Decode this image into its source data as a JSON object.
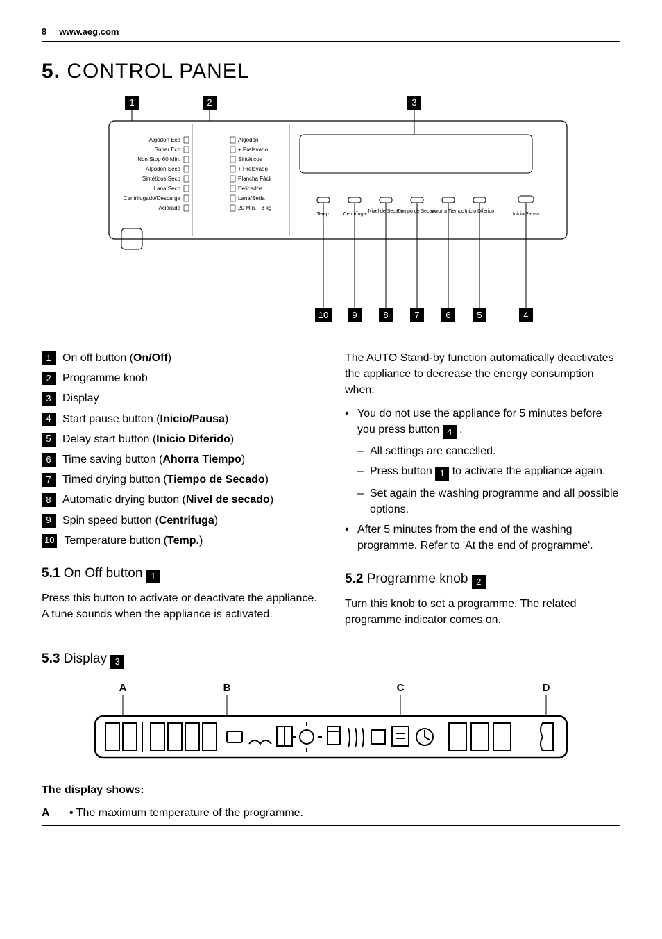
{
  "header": {
    "page_num": "8",
    "site": "www.aeg.com"
  },
  "title": {
    "num": "5.",
    "text": "CONTROL PANEL"
  },
  "panel": {
    "top_callouts": [
      "1",
      "2",
      "3"
    ],
    "bottom_callouts": [
      "10",
      "9",
      "8",
      "7",
      "6",
      "5",
      "4"
    ],
    "left_labels": [
      "Algodón Eco",
      "Super Eco",
      "Non Stop 60 Min.",
      "Algodón Seco",
      "Sintéticos Seco",
      "Lana Seco",
      "Centrifugado/Descarga",
      "Aclarado"
    ],
    "right_labels": [
      "Algodón",
      "+ Prelavado",
      "Sintéticos",
      "+ Prelavado",
      "Plancha Fácil",
      "Delicados",
      "Lana/Seda",
      "20 Min. · 3 kg"
    ],
    "button_labels": [
      "Temp.",
      "Centrífuga",
      "Nivel de Secado",
      "Tiempo de Secado",
      "Ahorra Tiempo",
      "Inicio Diferido",
      "Inicio/Pausa"
    ]
  },
  "legend": [
    {
      "n": "1",
      "text": "On off button (",
      "bold": "On/Off",
      "after": ")"
    },
    {
      "n": "2",
      "text": "Programme knob",
      "bold": "",
      "after": ""
    },
    {
      "n": "3",
      "text": "Display",
      "bold": "",
      "after": ""
    },
    {
      "n": "4",
      "text": "Start pause button (",
      "bold": "Inicio/Pausa",
      "after": ")"
    },
    {
      "n": "5",
      "text": "Delay start button (",
      "bold": "Inicio Diferido",
      "after": ")"
    },
    {
      "n": "6",
      "text": "Time saving button (",
      "bold": "Ahorra Tiempo",
      "after": ")"
    },
    {
      "n": "7",
      "text": "Timed drying button (",
      "bold": "Tiempo de Secado",
      "after": ")"
    },
    {
      "n": "8",
      "text": "Automatic drying button (",
      "bold": "Nivel de secado",
      "after": ")"
    },
    {
      "n": "9",
      "text": "Spin speed button (",
      "bold": "Centrifuga",
      "after": ")"
    },
    {
      "n": "10",
      "text": "Temperature button (",
      "bold": "Temp.",
      "after": ")"
    }
  ],
  "sec51": {
    "num": "5.1",
    "title": "On Off button",
    "badge": "1",
    "body": "Press this button to activate or deactivate the appliance. A tune sounds when the appliance is activated."
  },
  "right_col": {
    "intro": "The AUTO Stand-by function automatically deactivates the appliance to decrease the energy consumption when:",
    "b1_a": "You do not use the appliance for 5 minutes before you press button ",
    "b1_badge": "4",
    "b1_b": " .",
    "d1": "All settings are cancelled.",
    "d2_a": "Press button ",
    "d2_badge": "1",
    "d2_b": " to activate the appliance again.",
    "d3": "Set again the washing programme and all possible options.",
    "b2": "After 5 minutes from the end of the washing programme. Refer to 'At the end of programme'."
  },
  "sec52": {
    "num": "5.2",
    "title": "Programme knob",
    "badge": "2",
    "body": "Turn this knob to set a programme. The related programme indicator comes on."
  },
  "sec53": {
    "num": "5.3",
    "title": "Display",
    "badge": "3",
    "letters": [
      "A",
      "B",
      "C",
      "D"
    ],
    "table_title": "The display shows:",
    "rowA_label": "A",
    "rowA_desc": "The maximum temperature of the programme."
  }
}
